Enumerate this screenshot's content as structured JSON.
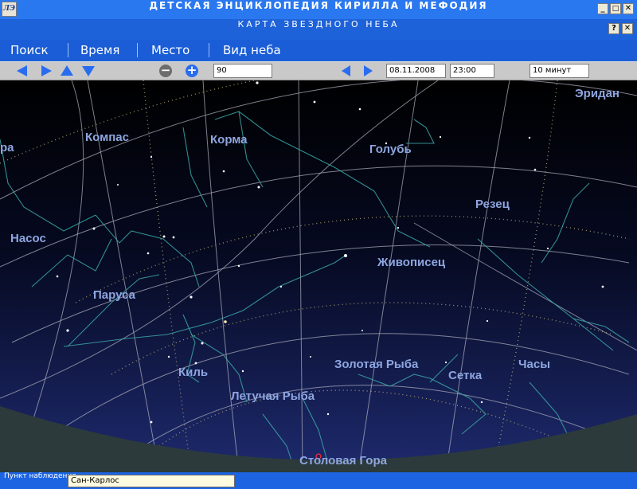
{
  "window": {
    "app_title": "ДЕТСКАЯ ЭНЦИКЛОПЕДИЯ КИРИЛЛА И МЕФОДИЯ",
    "logo_text": "ЛЭ",
    "sub_title": "КАРТА ЗВЕЗДНОГО НЕБА",
    "minimize": "_",
    "maximize": "□",
    "close": "✕",
    "help": "?"
  },
  "menu": [
    "Поиск",
    "Время",
    "Место",
    "Вид неба"
  ],
  "toolbar": {
    "zoom_value": "90",
    "date": "08.11.2008",
    "time": "23:00",
    "step": "10 минут",
    "zoom_out_label": "−",
    "zoom_in_label": "+"
  },
  "sky": {
    "constellations": [
      "Эридан",
      "Компас",
      "Корма",
      "Голубь",
      "Резец",
      "Насос",
      "Живописец",
      "Паруса",
      "Золотая Рыба",
      "Сетка",
      "Часы",
      "Киль",
      "Летучая Рыба",
      "Столовая Гора",
      "ра"
    ]
  },
  "status": {
    "location_label": "Пункт наблюдения",
    "location_value": "Сан-Карлос"
  },
  "colors": {
    "sky_top": "#000000",
    "sky_bottom": "#1e2a6e",
    "ground": "#2c3a3c",
    "grid": "#a8aab8",
    "constellation_lines": "#3aa6a6",
    "labels": "#8ea6e0",
    "toolbar_arrows": "#2a6cf0"
  }
}
